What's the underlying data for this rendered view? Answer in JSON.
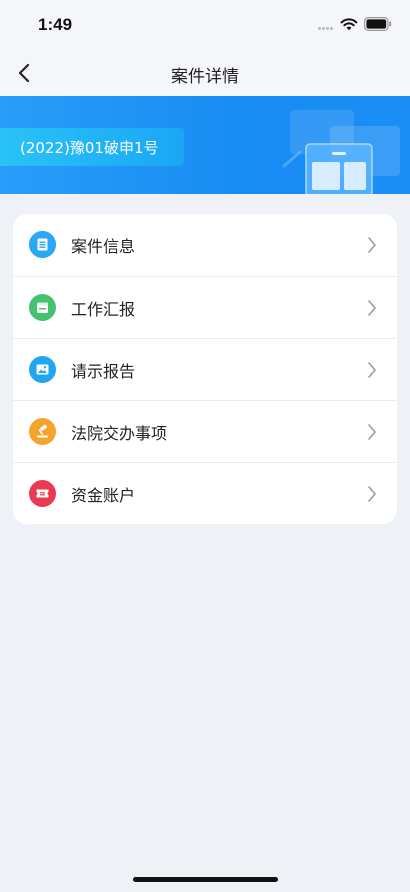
{
  "status_bar": {
    "time": "1:49",
    "icons": [
      "signal-dots-icon",
      "wifi-icon",
      "battery-icon"
    ]
  },
  "nav": {
    "back_icon": "chevron-left-icon",
    "title": "案件详情"
  },
  "banner": {
    "case_number": "(2022)豫01破申1号",
    "colors": {
      "background": "#1b8ef5",
      "tag": "#1aa6f5"
    }
  },
  "menu": {
    "items": [
      {
        "label": "案件信息",
        "icon": "document-list-icon",
        "color": "#1e9bf0"
      },
      {
        "label": "工作汇报",
        "icon": "calendar-icon",
        "color": "#3fbf6b"
      },
      {
        "label": "请示报告",
        "icon": "image-report-icon",
        "color": "#1aa3ee"
      },
      {
        "label": "法院交办事项",
        "icon": "gavel-icon",
        "color": "#f19a2a"
      },
      {
        "label": "资金账户",
        "icon": "ticket-icon",
        "color": "#e8384f"
      }
    ],
    "chevron_icon": "chevron-right-icon"
  }
}
